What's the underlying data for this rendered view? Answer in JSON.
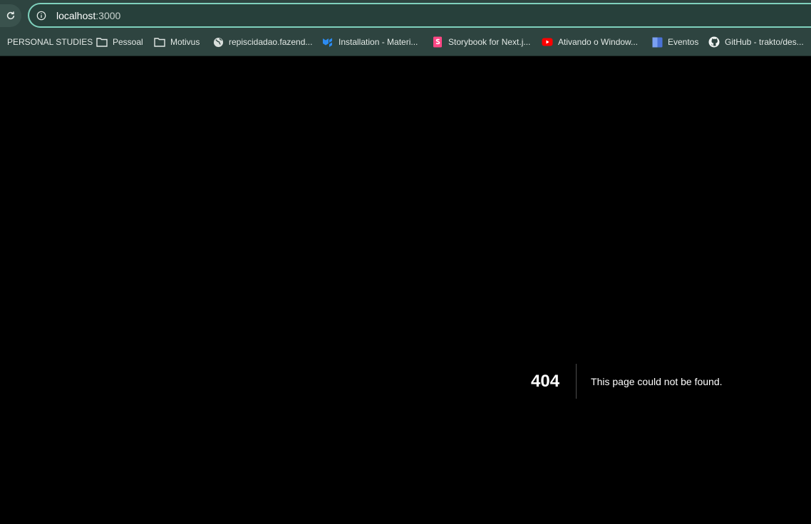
{
  "browser": {
    "address_bar": {
      "host": "localhost",
      "port": ":3000"
    }
  },
  "bookmarks": [
    {
      "label": "PERSONAL STUDIES",
      "icon": "folder-icon"
    },
    {
      "label": "Pessoal",
      "icon": "folder-icon"
    },
    {
      "label": "Motivus",
      "icon": "folder-icon"
    },
    {
      "label": "repiscidadao.fazend...",
      "icon": "globe-icon"
    },
    {
      "label": "Installation - Materi...",
      "icon": "mui-logo-icon"
    },
    {
      "label": "Storybook for Next.j...",
      "icon": "storybook-logo-icon"
    },
    {
      "label": "Ativando o Window...",
      "icon": "youtube-logo-icon"
    },
    {
      "label": "Eventos",
      "icon": "calendar-icon"
    },
    {
      "label": "GitHub - trakto/des...",
      "icon": "github-logo-icon"
    }
  ],
  "page": {
    "error_code": "404",
    "error_message": "This page could not be found."
  },
  "colors": {
    "toolbar": "#2e4440",
    "omnibox_border": "#7fd1bd",
    "page_background": "#000000"
  }
}
